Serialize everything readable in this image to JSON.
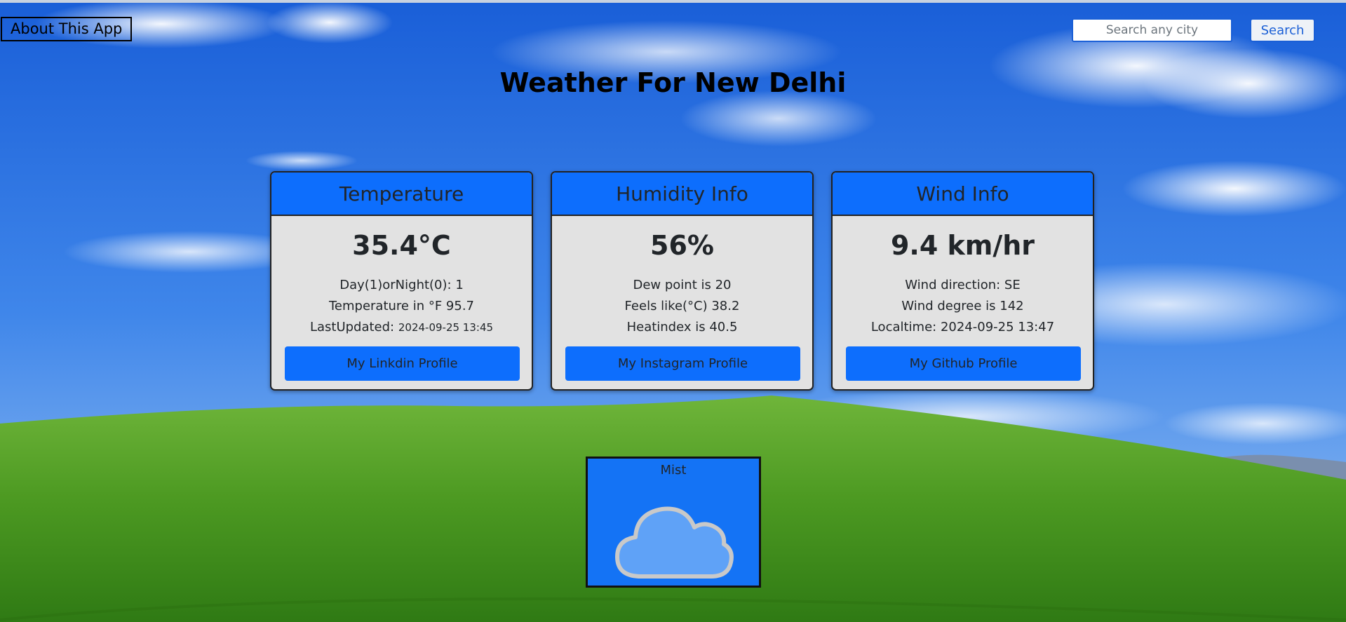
{
  "header": {
    "about_label": "About This App",
    "search_placeholder": "Search any city",
    "search_label": "Search"
  },
  "page_title": "Weather For New Delhi",
  "cards": [
    {
      "title": "Temperature",
      "value": "35.4°C",
      "lines": [
        "Day(1)orNight(0): 1",
        "Temperature in °F 95.7"
      ],
      "last_updated_label": "LastUpdated: ",
      "last_updated_value": "2024-09-25 13:45",
      "button": "My Linkdin Profile"
    },
    {
      "title": "Humidity Info",
      "value": "56%",
      "lines": [
        "Dew point is 20",
        "Feels like(°C) 38.2",
        "Heatindex is 40.5"
      ],
      "button": "My Instagram Profile"
    },
    {
      "title": "Wind Info",
      "value": "9.4 km/hr",
      "lines": [
        "Wind direction: SE",
        "Wind degree is 142",
        "Localtime: 2024-09-25 13:47"
      ],
      "button": "My Github Profile"
    }
  ],
  "condition": {
    "text": "Mist",
    "icon": "cloud-icon"
  },
  "colors": {
    "accent": "#0d6efd",
    "card_bg": "#e2e2e2",
    "condition_bg": "#1473f5"
  }
}
